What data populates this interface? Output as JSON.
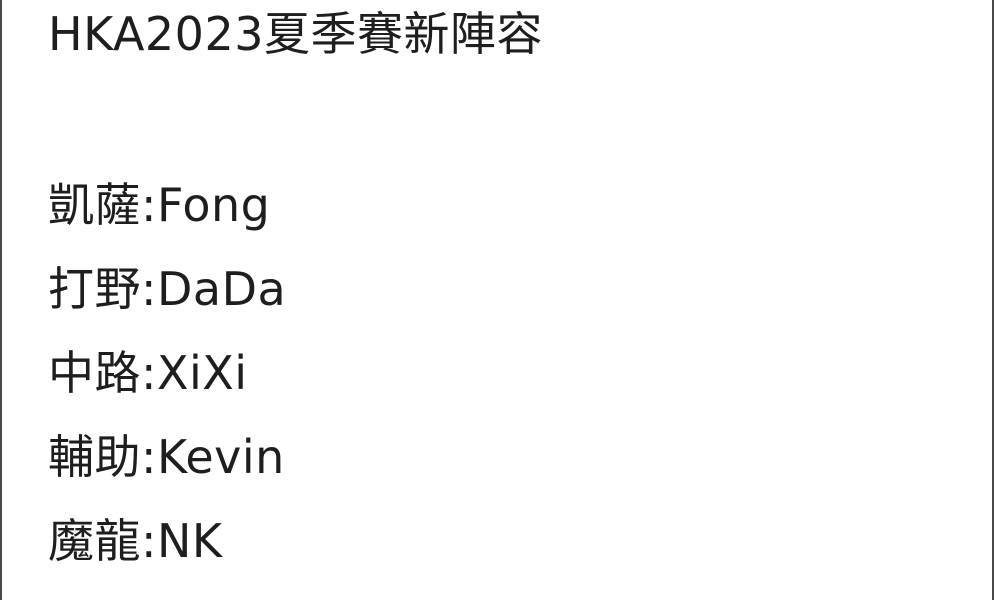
{
  "post": {
    "title": "HKA2023夏季賽新陣容",
    "roster": [
      {
        "line": "凱薩:Fong"
      },
      {
        "line": "打野:DaDa"
      },
      {
        "line": "中路:XiXi"
      },
      {
        "line": "輔助:Kevin"
      },
      {
        "line": "魔龍:NK"
      }
    ]
  },
  "colors": {
    "background": "#ffffff",
    "text": "#1e1e1e",
    "edge": "#4a4a4a"
  }
}
